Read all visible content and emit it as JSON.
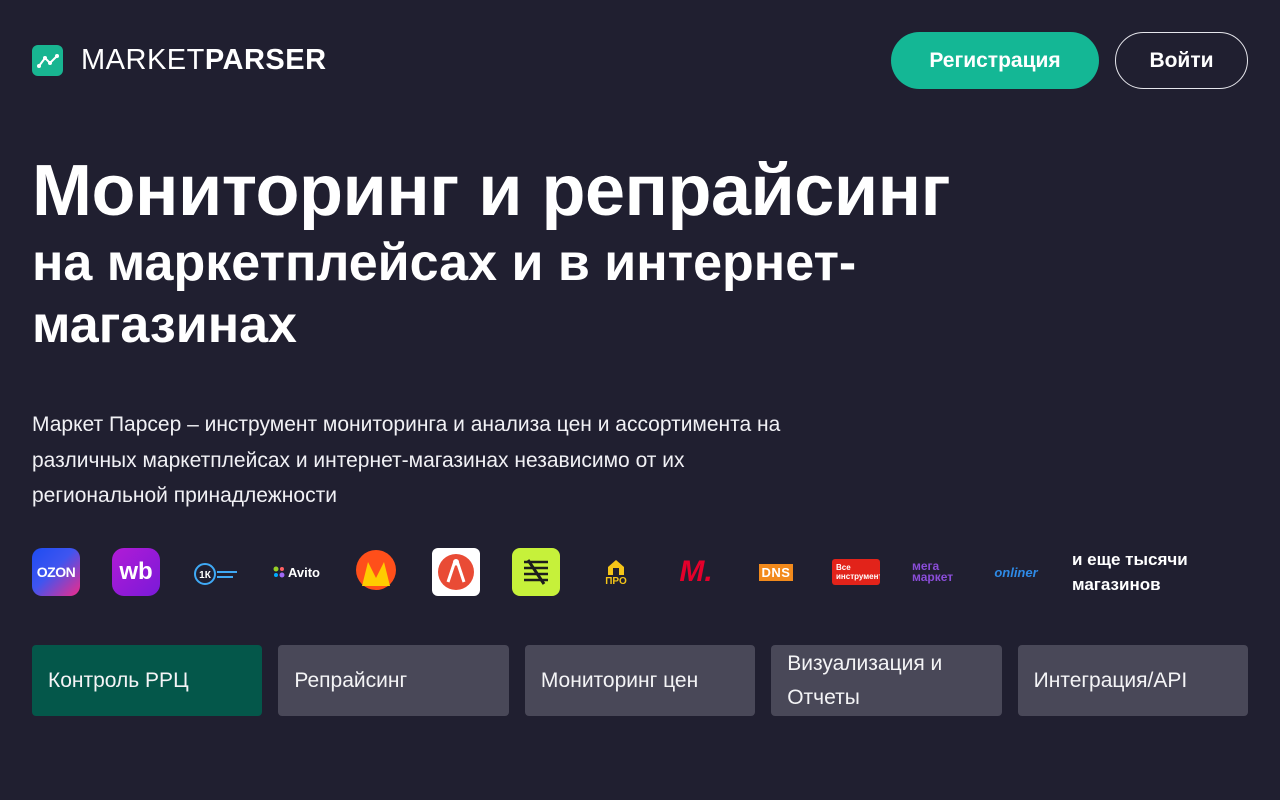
{
  "brand": {
    "name_light": "MARKET",
    "name_bold": "PARSER",
    "accent_color": "#18b591"
  },
  "header": {
    "register_label": "Регистрация",
    "login_label": "Войти"
  },
  "hero": {
    "title": "Мониторинг и репрайсинг",
    "subtitle": "на маркетплейсах и в интернет-магазинах",
    "description": "Маркет Парсер – инструмент мониторинга и анализа цен и ассортимента на различных маркетплейсах и интернет-магазинах независимо от их региональной принадлежности"
  },
  "marketplaces": [
    {
      "name": "ozon-logo",
      "text": "OZON"
    },
    {
      "name": "wildberries-logo",
      "text": "wb"
    },
    {
      "name": "pervyi-vitamin-logo",
      "text": "1К"
    },
    {
      "name": "avito-logo",
      "text": "Avito"
    },
    {
      "name": "yandex-market-logo",
      "text": ""
    },
    {
      "name": "apteka-ru-logo",
      "text": ""
    },
    {
      "name": "vkusvill-logo",
      "text": ""
    },
    {
      "name": "petrovich-pro-logo",
      "text": "ПРО"
    },
    {
      "name": "mvideo-logo",
      "text": "М."
    },
    {
      "name": "dns-logo",
      "text": "DNS"
    },
    {
      "name": "vse-instrumenty-logo",
      "text": "Все инструменты"
    },
    {
      "name": "megamarket-logo",
      "text": "мега маркет"
    },
    {
      "name": "onliner-logo",
      "text": "onliner"
    }
  ],
  "more_shops": "и еще тысячи магазинов",
  "tabs": [
    {
      "label": "Контроль РРЦ",
      "active": true
    },
    {
      "label": "Репрайсинг",
      "active": false
    },
    {
      "label": "Мониторинг цен",
      "active": false
    },
    {
      "label": "Визуализация и Отчеты",
      "active": false
    },
    {
      "label": "Интеграция/API",
      "active": false
    }
  ],
  "colors": {
    "background": "#201f30",
    "primary_button": "#14b795",
    "active_tab": "#04574a",
    "tab": "#494858"
  }
}
